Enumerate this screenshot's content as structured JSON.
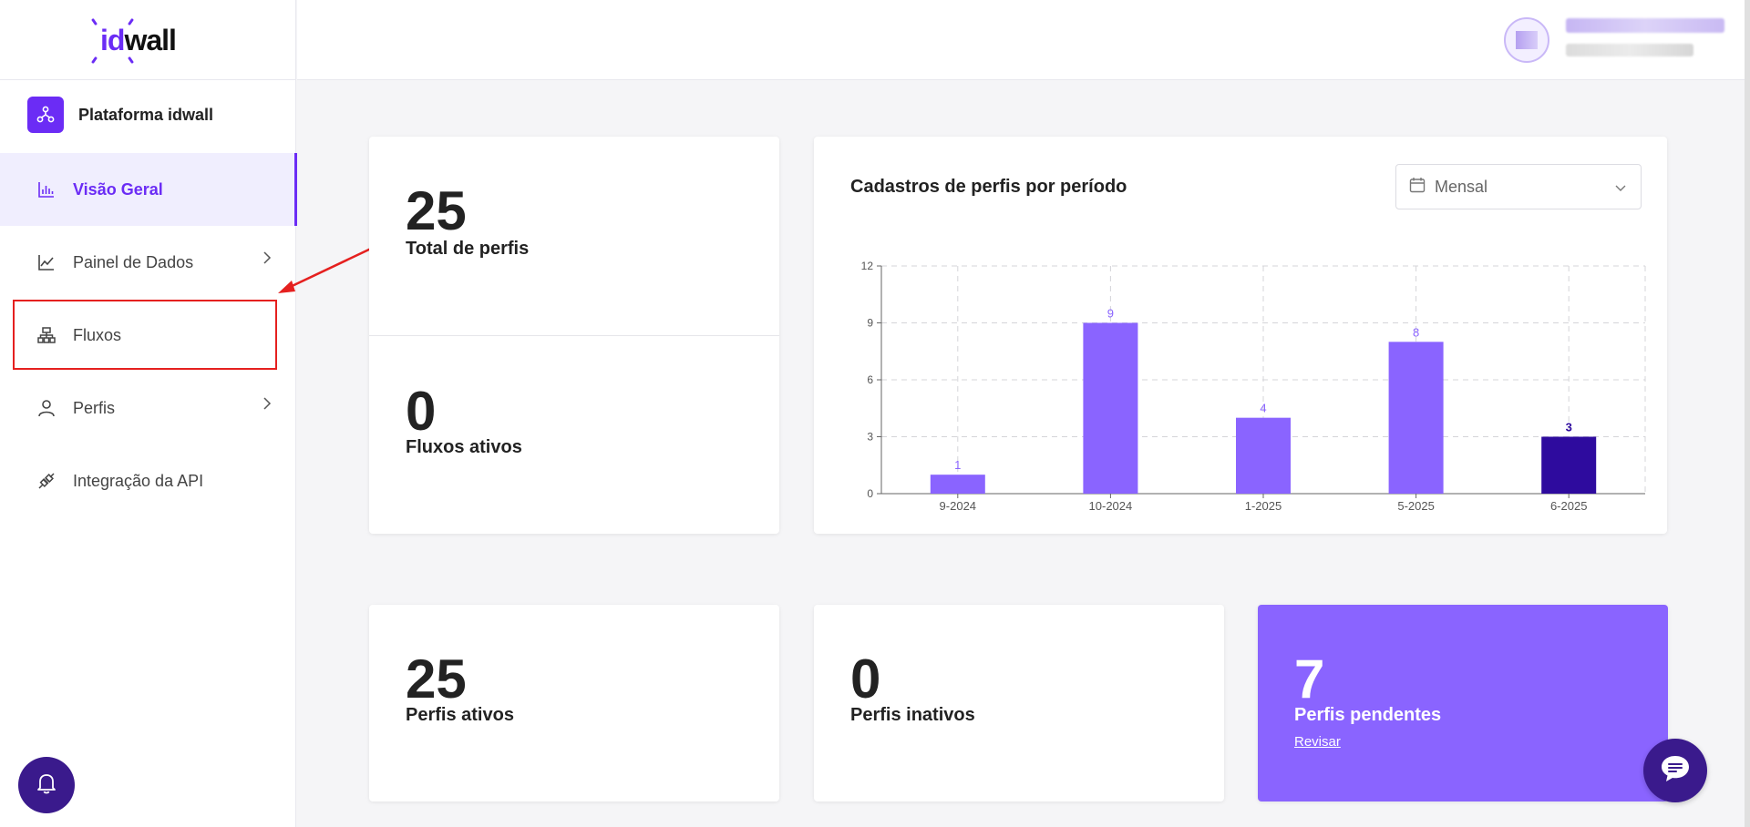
{
  "brand": {
    "logo_id": "id",
    "logo_wall": "wall",
    "platform_name": "Plataforma idwall"
  },
  "sidebar": {
    "items": [
      {
        "label": "Visão Geral",
        "icon": "bar-chart-icon",
        "active": true
      },
      {
        "label": "Painel de Dados",
        "icon": "line-chart-icon",
        "has_chevron": true
      },
      {
        "label": "Fluxos",
        "icon": "sitemap-icon"
      },
      {
        "label": "Perfis",
        "icon": "user-icon",
        "has_chevron": true
      },
      {
        "label": "Integração da API",
        "icon": "plug-icon"
      }
    ]
  },
  "metrics": {
    "total_profiles": {
      "value": "25",
      "label": "Total de perfis"
    },
    "active_flows": {
      "value": "0",
      "label": "Fluxos ativos"
    },
    "active_profiles": {
      "value": "25",
      "label": "Perfis ativos"
    },
    "inactive_profiles": {
      "value": "0",
      "label": "Perfis inativos"
    },
    "pending_profiles": {
      "value": "7",
      "label": "Perfis pendentes",
      "link": "Revisar"
    }
  },
  "chart_section": {
    "title": "Cadastros de perfis por período",
    "period_select": "Mensal"
  },
  "chart_data": {
    "type": "bar",
    "categories": [
      "9-2024",
      "10-2024",
      "1-2025",
      "5-2025",
      "6-2025"
    ],
    "values": [
      1,
      9,
      4,
      8,
      3
    ],
    "ylim": [
      0,
      12
    ],
    "yticks": [
      0,
      3,
      6,
      9,
      12
    ],
    "grid": true,
    "colors": {
      "default": "#8a64ff",
      "highlighted": "#2e0b9e"
    },
    "highlighted_index": 4,
    "title": "",
    "xlabel": "",
    "ylabel": ""
  },
  "colors": {
    "accent": "#6b2cf5",
    "dark_accent": "#3a1a8c",
    "highlight_border": "#e5201f"
  }
}
